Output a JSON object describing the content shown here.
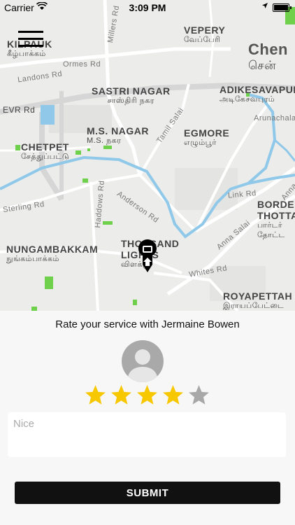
{
  "status_bar": {
    "carrier": "Carrier",
    "time": "3:09 PM"
  },
  "map": {
    "labels": {
      "kilpauk": "KILPAUK",
      "kilpauk_tamil": "கீழ்பாக்கம்",
      "vepery": "VEPERY",
      "vepery_tamil": "வேப்பேரி",
      "chennai": "Chen",
      "chennai_tamil": "சென்",
      "ormes_rd": "Ormes Rd",
      "millers_rd": "Millers Rd",
      "landons_rd": "Landons Rd",
      "sastri_nagar": "SASTRI NAGAR",
      "sastri_nagar_tamil": "சாஸ்திரி நகர",
      "adikesavapuram": "ADIKESAVAPURA",
      "adikesavapuram_tamil": "அடிகேசவபுரம்",
      "evr_rd": "EVR Rd",
      "arunachala": "Arunachala",
      "ms_nagar": "M.S. NAGAR",
      "ms_nagar_tamil": "M.S. நகர",
      "egmore": "EGMORE",
      "egmore_tamil": "எழும்பூர்",
      "tamil_salai": "Tamil Salai",
      "chetpet": "CHETPET",
      "chetpet_tamil": "சேத்துப்பட்டு",
      "sterling_rd": "Sterling Rd",
      "haddows_rd": "Haddows Rd",
      "anderson_rd": "Anderson Rd",
      "link_rd": "Link Rd",
      "anna_salai_right": "Anna",
      "border_thotta": "BORDE",
      "border_thotta2": "THOTTA",
      "border_tamil": "பார்டர்",
      "border_tamil2": "தோட்ட",
      "anna_salai": "Anna Salai",
      "nungambakkam": "NUNGAMBAKKAM",
      "nungambakkam_tamil": "நுங்கம்பாக்கம்",
      "thousand_lights": "THOUSAND",
      "thousand_lights2": "LIGHTS",
      "thousand_tamil": "விளக்கு",
      "whites_rd": "Whites Rd",
      "royapettah": "ROYAPETTAH",
      "royapettah_tamil": "இராயப்பேட்டை"
    }
  },
  "rating": {
    "title": "Rate your service with Jermaine Bowen",
    "value": 4,
    "max": 5,
    "comment_placeholder": "Nice",
    "submit_label": "SUBMIT"
  },
  "colors": {
    "star_filled": "#f7c700",
    "star_empty": "#a8a8a8",
    "water": "#8fc8e8",
    "park": "#6fd04b",
    "button": "#111111"
  }
}
